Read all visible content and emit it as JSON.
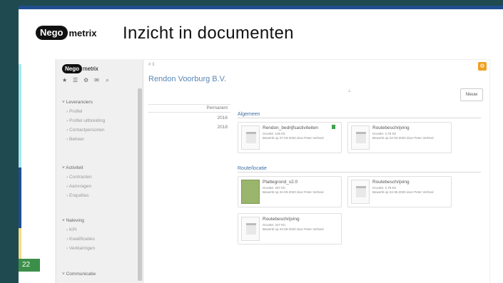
{
  "slide": {
    "brand": {
      "pill": "Nego",
      "rest": "metrix"
    },
    "title": "Inzicht in documenten",
    "page_number": "22",
    "colors": {
      "frame": "#1f4b50",
      "topbar": "#1f4e8f",
      "accent_green": "#3c8f49"
    }
  },
  "app": {
    "brand": {
      "pill": "Nego",
      "rest": "metrix"
    },
    "sidebar_icons": [
      "star-icon",
      "list-icon",
      "settings-icon",
      "mail-icon",
      "search-icon"
    ],
    "sections": [
      {
        "title": "Leveranciers",
        "items": [
          "Profiel",
          "Profiel uitbreiding",
          "Contactpersonen",
          "Beheer"
        ]
      },
      {
        "title": "Activiteit",
        "items": [
          "Contracten",
          "Aanvragen",
          "Enquêtes"
        ]
      },
      {
        "title": "Naleving",
        "items": [
          "KPI",
          "Kwalificaties",
          "Verklaringen"
        ]
      },
      {
        "title": "Communicatie",
        "items": []
      }
    ],
    "breadcrumb": "# 3",
    "company": "Rendon Voorburg B.V.",
    "edit_label": "Nieuw",
    "years_header": "Permanent",
    "years": [
      "2016",
      "2018"
    ],
    "categories": [
      {
        "name": "Algemeen",
        "docs": [
          {
            "title": "Rendon_bedrijfsactiviteiten",
            "size": "Grootte: 105 Kb",
            "meta": "Bewerkt op 27-03-2020 door Peter Verheul"
          },
          {
            "title": "Routebeschrijving",
            "size": "Grootte: 2,78 Kb",
            "meta": "Bewerkt op 22-03-2020 door Peter Verheul"
          }
        ]
      },
      {
        "name": "Route/locatie",
        "docs": [
          {
            "title": "Plattegrond_v2.0",
            "size": "Grootte: 287 Kb",
            "meta": "Bewerkt op 24-05-2020 door Peter Verheul"
          },
          {
            "title": "Routebeschrijving",
            "size": "Grootte: 2,78 Kb",
            "meta": "Bewerkt op 24-05-2020 door Peter Verheul"
          },
          {
            "title": "Routebeschrijving",
            "size": "Grootte: 227 Kb",
            "meta": "Bewerkt op 24-05-2020 door Peter Verheul"
          }
        ]
      }
    ]
  }
}
